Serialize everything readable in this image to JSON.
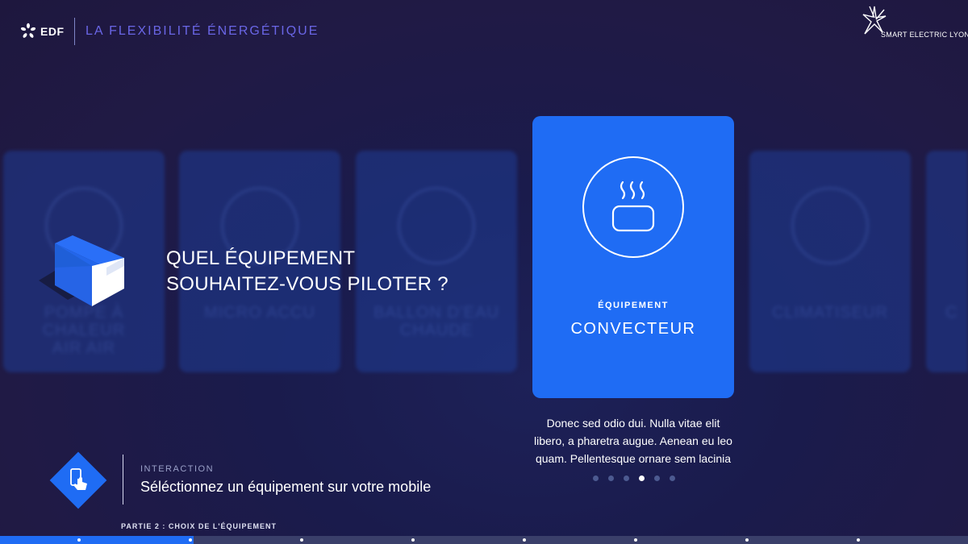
{
  "header": {
    "edf_logo_text": "EDF",
    "title": "LA FLEXIBILITÉ ÉNERGÉTIQUE",
    "partner_logo_text": "SMART ELECTRIC LYON"
  },
  "question": {
    "line1": "QUEL ÉQUIPEMENT",
    "line2": "SOUHAITEZ-VOUS PILOTER ?"
  },
  "carousel": {
    "background_cards": [
      {
        "name_line1": "POMPE À",
        "name_line2": "CHALEUR",
        "name_line3": "AIR AIR"
      },
      {
        "name_line1": "MICRO ACCU",
        "name_line2": "",
        "name_line3": ""
      },
      {
        "name_line1": "BALLON D'EAU",
        "name_line2": "CHAUDE",
        "name_line3": ""
      },
      {
        "name_line1": "CLIMATISEUR",
        "name_line2": "",
        "name_line3": ""
      },
      {
        "name_line1": "C",
        "name_line2": "",
        "name_line3": ""
      }
    ],
    "active_card": {
      "label": "ÉQUIPEMENT",
      "name": "CONVECTEUR",
      "icon": "heater-icon"
    },
    "description": "Donec sed odio dui. Nulla vitae elit libero, a pharetra augue. Aenean eu leo quam. Pellentesque ornare sem lacinia",
    "page_count": 6,
    "current_page": 4
  },
  "interaction": {
    "label": "INTERACTION",
    "text": "Séléctionnez un équipement sur votre mobile",
    "icon": "phone-tap-icon"
  },
  "part_label": "PARTIE 2 : CHOIX DE L'ÉQUIPEMENT",
  "progress": {
    "fraction": 0.2,
    "markers": 8
  },
  "colors": {
    "accent": "#1f6cf4",
    "header_title": "#6a66e6",
    "background": "#1e1a45"
  }
}
